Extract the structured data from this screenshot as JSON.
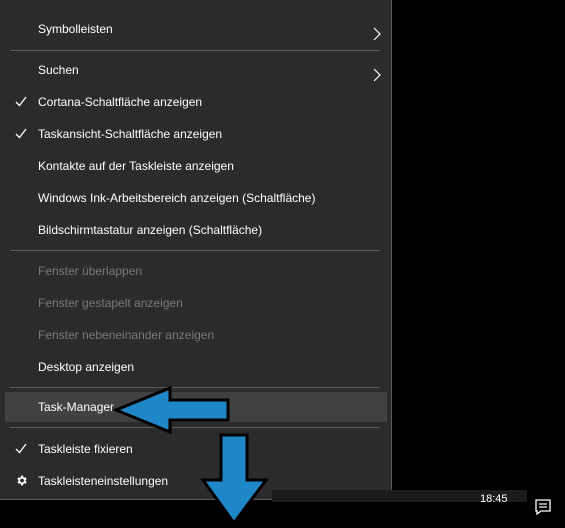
{
  "menu": {
    "items": [
      {
        "label": "Symbolleisten",
        "checked": false,
        "submenu": true,
        "disabled": false
      },
      {
        "label": "Suchen",
        "checked": false,
        "submenu": true,
        "disabled": false
      },
      {
        "label": "Cortana-Schaltfläche anzeigen",
        "checked": true,
        "submenu": false,
        "disabled": false
      },
      {
        "label": "Taskansicht-Schaltfläche anzeigen",
        "checked": true,
        "submenu": false,
        "disabled": false
      },
      {
        "label": "Kontakte auf der Taskleiste anzeigen",
        "checked": false,
        "submenu": false,
        "disabled": false
      },
      {
        "label": "Windows Ink-Arbeitsbereich anzeigen (Schaltfläche)",
        "checked": false,
        "submenu": false,
        "disabled": false
      },
      {
        "label": "Bildschirmtastatur anzeigen (Schaltfläche)",
        "checked": false,
        "submenu": false,
        "disabled": false
      },
      {
        "label": "Fenster überlappen",
        "checked": false,
        "submenu": false,
        "disabled": true
      },
      {
        "label": "Fenster gestapelt anzeigen",
        "checked": false,
        "submenu": false,
        "disabled": true
      },
      {
        "label": "Fenster nebeneinander anzeigen",
        "checked": false,
        "submenu": false,
        "disabled": true
      },
      {
        "label": "Desktop anzeigen",
        "checked": false,
        "submenu": false,
        "disabled": false
      },
      {
        "label": "Task-Manager",
        "checked": false,
        "submenu": false,
        "disabled": false,
        "highlighted": true
      },
      {
        "label": "Taskleiste fixieren",
        "checked": true,
        "submenu": false,
        "disabled": false
      },
      {
        "label": "Taskleisteneinstellungen",
        "checked": false,
        "submenu": false,
        "disabled": false,
        "icon": "gear-icon"
      }
    ]
  },
  "taskbar": {
    "clock": "18:45",
    "notification_icon": "action-center-icon"
  },
  "annotations": {
    "arrow_left_icon": "arrow-left-icon",
    "arrow_down_icon": "arrow-down-icon",
    "arrow_color": "#1f87c8"
  }
}
